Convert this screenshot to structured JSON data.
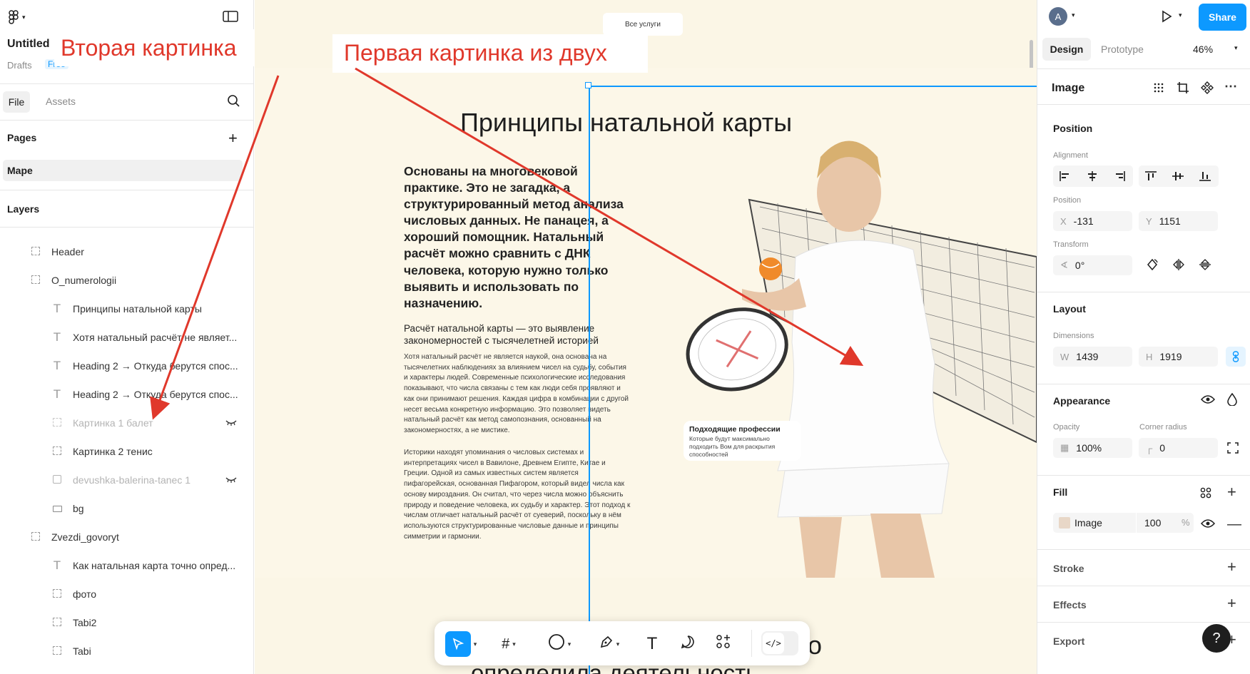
{
  "file": {
    "title": "Untitled",
    "location": "Drafts",
    "plan_badge": "Free"
  },
  "left_tabs": {
    "file": "File",
    "assets": "Assets"
  },
  "pages": {
    "heading": "Pages",
    "items": [
      "Mape"
    ]
  },
  "layers": {
    "heading": "Layers",
    "items": [
      {
        "label": "Header",
        "icon": "frame-icon",
        "hidden": false
      },
      {
        "label": "O_numerologii",
        "icon": "frame-icon",
        "hidden": false
      },
      {
        "label": "Принципы натальной карты",
        "icon": "text-icon",
        "hidden": false
      },
      {
        "label": "Хотя натальный расчёт не являет...",
        "icon": "text-icon",
        "hidden": false
      },
      {
        "label": "Heading 2 → Откуда берутся спос...",
        "icon": "text-icon",
        "hidden": false
      },
      {
        "label": "Heading 2 → Откуда берутся спос...",
        "icon": "text-icon",
        "hidden": false
      },
      {
        "label": "Картинка 1 балет",
        "icon": "frame-icon",
        "hidden": true
      },
      {
        "label": "Картинка 2 тенис",
        "icon": "frame-icon",
        "hidden": false
      },
      {
        "label": "devushka-balerina-tanec 1",
        "icon": "image-icon",
        "hidden": true
      },
      {
        "label": "bg",
        "icon": "rectangle-icon",
        "hidden": false
      },
      {
        "label": "Zvezdi_govoryt",
        "icon": "frame-icon",
        "hidden": false
      },
      {
        "label": "Как натальная карта точно опред...",
        "icon": "text-icon",
        "hidden": false
      },
      {
        "label": "фото",
        "icon": "frame-icon",
        "hidden": false
      },
      {
        "label": "Tabi2",
        "icon": "frame-icon",
        "hidden": false
      },
      {
        "label": "Tabi",
        "icon": "frame-icon",
        "hidden": false
      }
    ]
  },
  "annotations": {
    "second": "Вторая картинка",
    "first": "Первая картинка из двух",
    "color": "#e0382b"
  },
  "canvas": {
    "top_button": "Все услуги",
    "heading": "Принципы натальной карты",
    "lead": "Основаны на многовековой практике. Это не загадка, а структурированный метод анализа числовых данных. Не панацея, а хороший помощник. Натальный расчёт можно сравнить с ДНК человека, которую нужно только выявить и использовать по назначению.",
    "sub_heading": "Расчёт натальной карты — это выявление закономерностей с тысячелетней историей",
    "para1": "Хотя натальный расчёт не является наукой, она основана на тысячелетних наблюдениях за влиянием чисел на судьбу, события и характеры людей. Современные психологические исследования показывают, что числа связаны с тем как люди себя проявляют и как они принимают решения. Каждая цифра в комбинации с другой несет весьма конкретную информацию. Это позволяет видеть натальный расчёт как метод самопознания, основанный на закономерностях, а не мистике.",
    "para2": "Историки находят упоминания о числовых системах и интерпретациях чисел в Вавилоне, Древнем Египте, Китае и Греции. Одной из самых известных систем является пифагорейская, основанная Пифагором, который видел числа как основу мироздания. Он считал, что через числа можно объяснить природу и поведение человека, их судьбу и характер. Этот подход к числам отличает натальный расчёт от суеверий, поскольку в нём используются структурированные числовые данные и принципы симметрии и гармонии.",
    "card_title": "Подходящие профессии",
    "card_text": "Которые будут максимально подходить Вом для раскрытия способностей",
    "next_heading_fragment": "определила деятельность",
    "next_heading_tail": "о"
  },
  "toolbar": {
    "tools": [
      "move-tool",
      "frame-tool",
      "shape-tool",
      "pen-tool",
      "text-tool",
      "comment-tool",
      "actions-tool",
      "dev-mode-toggle"
    ]
  },
  "right": {
    "avatar_letter": "A",
    "share": "Share",
    "tabs": {
      "design": "Design",
      "prototype": "Prototype"
    },
    "zoom": "46%",
    "layer_type": "Image",
    "position_heading": "Position",
    "alignment_label": "Alignment",
    "position_label": "Position",
    "x_label": "X",
    "x": "-131",
    "y_label": "Y",
    "y": "1151",
    "transform_label": "Transform",
    "rotation": "0°",
    "layout_heading": "Layout",
    "dimensions_label": "Dimensions",
    "w_label": "W",
    "w": "1439",
    "h_label": "H",
    "h": "1919",
    "appearance_heading": "Appearance",
    "opacity_label": "Opacity",
    "opacity": "100%",
    "radius_label": "Corner radius",
    "radius": "0",
    "fill_heading": "Fill",
    "fill_type": "Image",
    "fill_opacity": "100",
    "fill_pct": "%",
    "stroke_heading": "Stroke",
    "effects_heading": "Effects",
    "export_heading": "Export",
    "help": "?",
    "accent": "#0d99ff"
  }
}
